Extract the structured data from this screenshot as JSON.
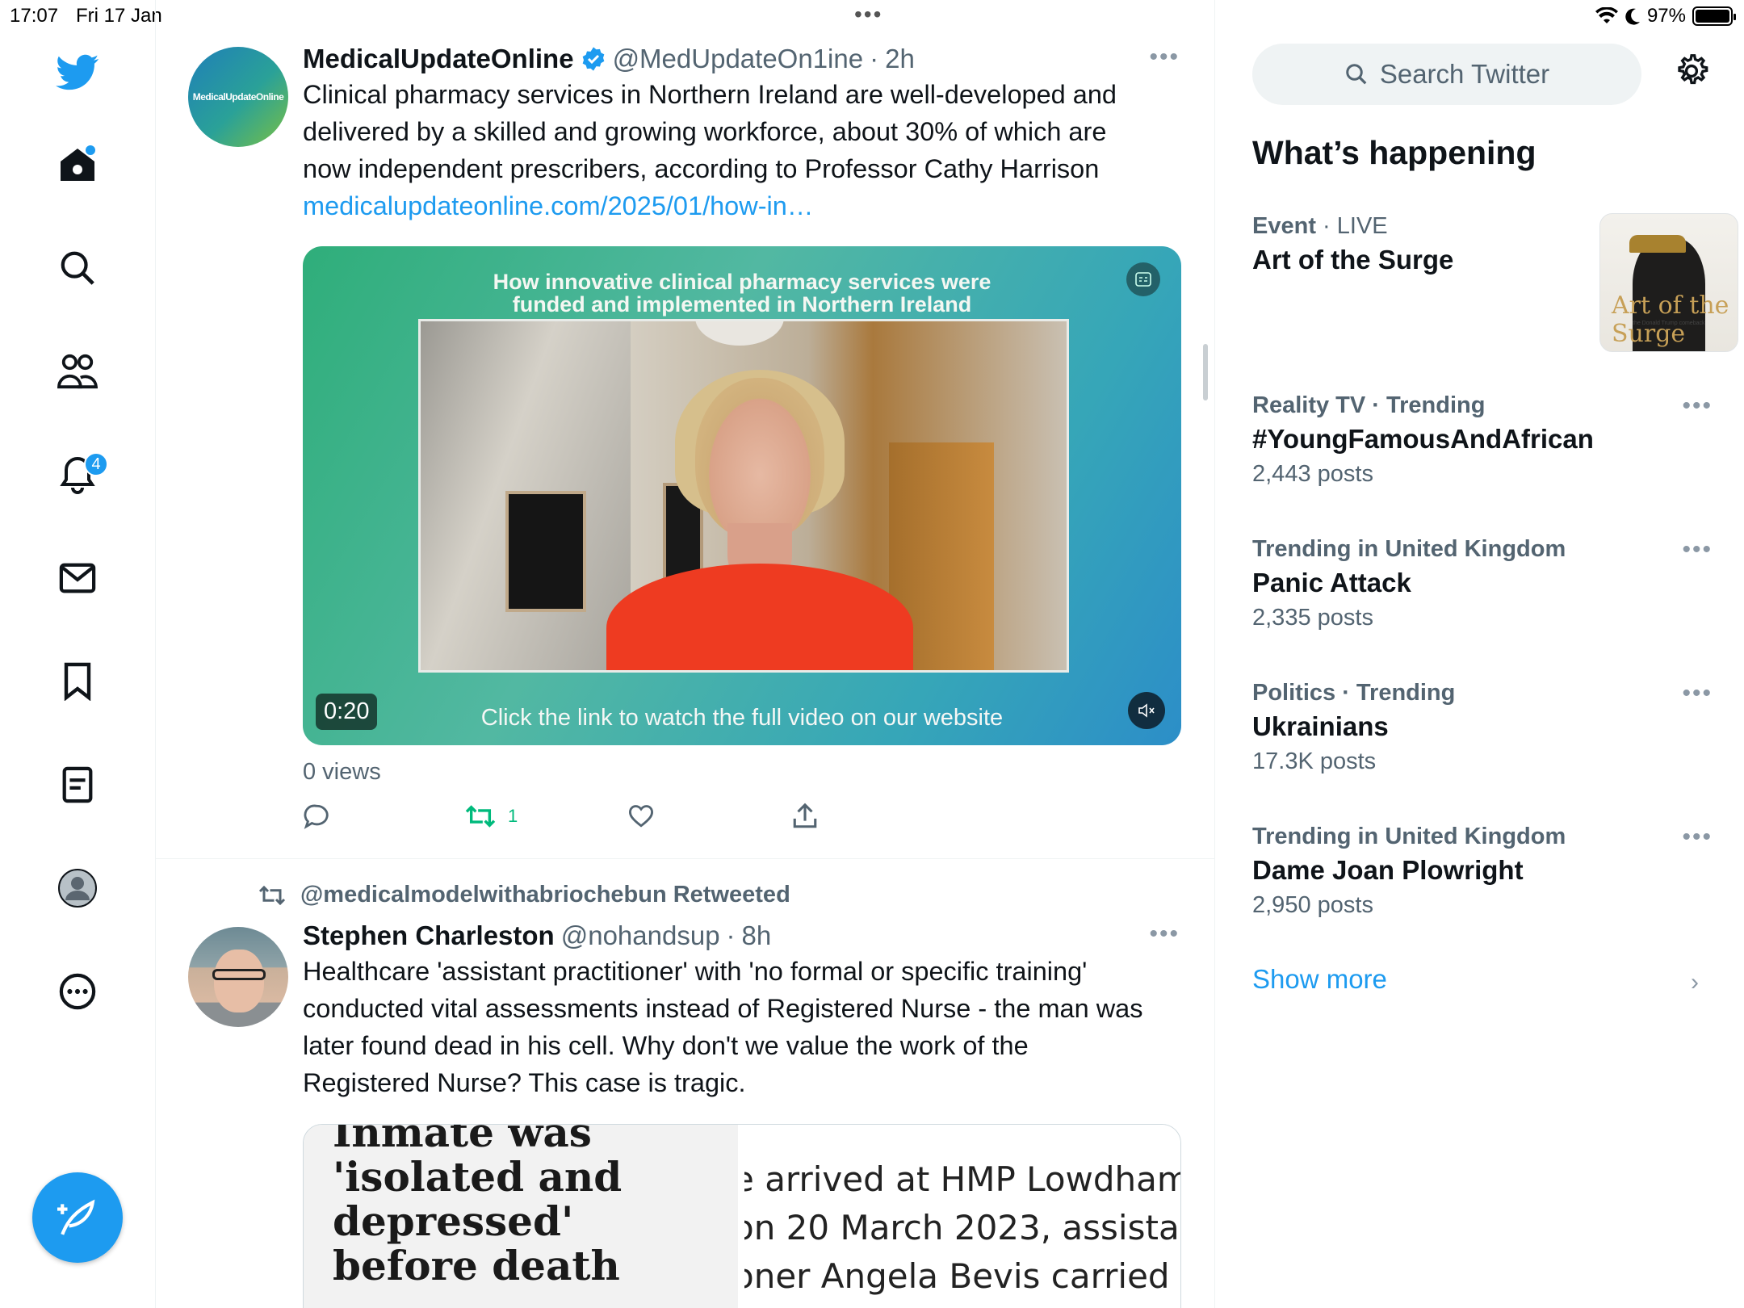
{
  "status_bar": {
    "time": "17:07",
    "date": "Fri 17 Jan",
    "battery": "97%",
    "battery_level": 0.97
  },
  "nav": {
    "items": [
      {
        "name": "twitter-logo",
        "icon": "bird-icon"
      },
      {
        "name": "home",
        "icon": "home-icon",
        "has_dot": true
      },
      {
        "name": "explore",
        "icon": "search-icon"
      },
      {
        "name": "communities",
        "icon": "people-icon"
      },
      {
        "name": "notifications",
        "icon": "bell-icon",
        "badge": "4"
      },
      {
        "name": "messages",
        "icon": "mail-icon"
      },
      {
        "name": "bookmarks",
        "icon": "bookmark-icon"
      },
      {
        "name": "lists",
        "icon": "list-icon"
      },
      {
        "name": "profile",
        "icon": "avatar-icon"
      },
      {
        "name": "more",
        "icon": "more-circle-icon"
      }
    ],
    "notification_badge": "4",
    "compose_icon": "compose-feather-icon"
  },
  "tweet1": {
    "avatar_text": "MedicalUpdateOnline",
    "name": "MedicalUpdateOnline",
    "verified": true,
    "handle": "@MedUpdateOn1ine",
    "separator": "·",
    "age": "2h",
    "text": "Clinical pharmacy services in Northern Ireland are well-developed and delivered by a skilled and growing workforce, about 30% of which are now independent prescribers, according to Professor Cathy Harrison",
    "link": "medicalupdateonline.com/2025/01/how-in…",
    "video": {
      "title_line1": "How innovative clinical pharmacy services were",
      "title_line2": "funded and implemented in Northern Ireland",
      "caption": "Click the link to watch the full video on our website",
      "duration": "0:20"
    },
    "views": "0 views",
    "retweet_count": "1",
    "accent_retweet": "#00ba7c"
  },
  "tweet2": {
    "retweeted_by": "@medicalmodelwithabriochebun Retweeted",
    "name": "Stephen Charleston",
    "handle": "@nohandsup",
    "separator": "·",
    "age": "8h",
    "text": "Healthcare 'assistant practitioner' with 'no formal or specific training' conducted vital assessments instead of Registered Nurse - the man was later found dead in his cell. Why don't we value the work of the Registered Nurse? This case is tragic.",
    "card_left": "Inmate was 'isolated and depressed' before death",
    "card_right_line1": "e arrived at HMP Lowdham",
    "card_right_line2": "on 20 March 2023, assistar",
    "card_right_line3": "oner Angela Bevis carried o"
  },
  "sidebar": {
    "search_placeholder": "Search Twitter",
    "heading": "What’s happening",
    "trends": [
      {
        "category": "Event",
        "live": "LIVE",
        "title": "Art of the Surge",
        "image_title": "Art of the Surge",
        "image_sub": "the Donald Trump comeback"
      },
      {
        "category": "Reality TV · Trending",
        "title": "#YoungFamousAndAfrican",
        "count": "2,443 posts"
      },
      {
        "category": "Trending in United Kingdom",
        "title": "Panic Attack",
        "count": "2,335 posts"
      },
      {
        "category": "Politics · Trending",
        "title": "Ukrainians",
        "count": "17.3K posts"
      },
      {
        "category": "Trending in United Kingdom",
        "title": "Dame Joan Plowright",
        "count": "2,950 posts"
      }
    ],
    "show_more": "Show more"
  },
  "colors": {
    "accent": "#1d9bf0",
    "text": "#0f1419",
    "secondary": "#536471"
  }
}
